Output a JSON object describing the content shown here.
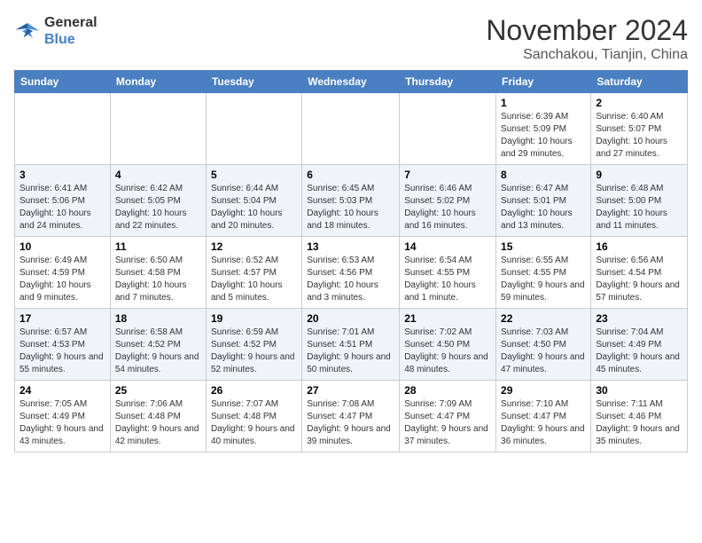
{
  "logo": {
    "line1": "General",
    "line2": "Blue"
  },
  "title": "November 2024",
  "location": "Sanchakou, Tianjin, China",
  "days_of_week": [
    "Sunday",
    "Monday",
    "Tuesday",
    "Wednesday",
    "Thursday",
    "Friday",
    "Saturday"
  ],
  "weeks": [
    [
      {
        "num": "",
        "info": ""
      },
      {
        "num": "",
        "info": ""
      },
      {
        "num": "",
        "info": ""
      },
      {
        "num": "",
        "info": ""
      },
      {
        "num": "",
        "info": ""
      },
      {
        "num": "1",
        "info": "Sunrise: 6:39 AM\nSunset: 5:09 PM\nDaylight: 10 hours and 29 minutes."
      },
      {
        "num": "2",
        "info": "Sunrise: 6:40 AM\nSunset: 5:07 PM\nDaylight: 10 hours and 27 minutes."
      }
    ],
    [
      {
        "num": "3",
        "info": "Sunrise: 6:41 AM\nSunset: 5:06 PM\nDaylight: 10 hours and 24 minutes."
      },
      {
        "num": "4",
        "info": "Sunrise: 6:42 AM\nSunset: 5:05 PM\nDaylight: 10 hours and 22 minutes."
      },
      {
        "num": "5",
        "info": "Sunrise: 6:44 AM\nSunset: 5:04 PM\nDaylight: 10 hours and 20 minutes."
      },
      {
        "num": "6",
        "info": "Sunrise: 6:45 AM\nSunset: 5:03 PM\nDaylight: 10 hours and 18 minutes."
      },
      {
        "num": "7",
        "info": "Sunrise: 6:46 AM\nSunset: 5:02 PM\nDaylight: 10 hours and 16 minutes."
      },
      {
        "num": "8",
        "info": "Sunrise: 6:47 AM\nSunset: 5:01 PM\nDaylight: 10 hours and 13 minutes."
      },
      {
        "num": "9",
        "info": "Sunrise: 6:48 AM\nSunset: 5:00 PM\nDaylight: 10 hours and 11 minutes."
      }
    ],
    [
      {
        "num": "10",
        "info": "Sunrise: 6:49 AM\nSunset: 4:59 PM\nDaylight: 10 hours and 9 minutes."
      },
      {
        "num": "11",
        "info": "Sunrise: 6:50 AM\nSunset: 4:58 PM\nDaylight: 10 hours and 7 minutes."
      },
      {
        "num": "12",
        "info": "Sunrise: 6:52 AM\nSunset: 4:57 PM\nDaylight: 10 hours and 5 minutes."
      },
      {
        "num": "13",
        "info": "Sunrise: 6:53 AM\nSunset: 4:56 PM\nDaylight: 10 hours and 3 minutes."
      },
      {
        "num": "14",
        "info": "Sunrise: 6:54 AM\nSunset: 4:55 PM\nDaylight: 10 hours and 1 minute."
      },
      {
        "num": "15",
        "info": "Sunrise: 6:55 AM\nSunset: 4:55 PM\nDaylight: 9 hours and 59 minutes."
      },
      {
        "num": "16",
        "info": "Sunrise: 6:56 AM\nSunset: 4:54 PM\nDaylight: 9 hours and 57 minutes."
      }
    ],
    [
      {
        "num": "17",
        "info": "Sunrise: 6:57 AM\nSunset: 4:53 PM\nDaylight: 9 hours and 55 minutes."
      },
      {
        "num": "18",
        "info": "Sunrise: 6:58 AM\nSunset: 4:52 PM\nDaylight: 9 hours and 54 minutes."
      },
      {
        "num": "19",
        "info": "Sunrise: 6:59 AM\nSunset: 4:52 PM\nDaylight: 9 hours and 52 minutes."
      },
      {
        "num": "20",
        "info": "Sunrise: 7:01 AM\nSunset: 4:51 PM\nDaylight: 9 hours and 50 minutes."
      },
      {
        "num": "21",
        "info": "Sunrise: 7:02 AM\nSunset: 4:50 PM\nDaylight: 9 hours and 48 minutes."
      },
      {
        "num": "22",
        "info": "Sunrise: 7:03 AM\nSunset: 4:50 PM\nDaylight: 9 hours and 47 minutes."
      },
      {
        "num": "23",
        "info": "Sunrise: 7:04 AM\nSunset: 4:49 PM\nDaylight: 9 hours and 45 minutes."
      }
    ],
    [
      {
        "num": "24",
        "info": "Sunrise: 7:05 AM\nSunset: 4:49 PM\nDaylight: 9 hours and 43 minutes."
      },
      {
        "num": "25",
        "info": "Sunrise: 7:06 AM\nSunset: 4:48 PM\nDaylight: 9 hours and 42 minutes."
      },
      {
        "num": "26",
        "info": "Sunrise: 7:07 AM\nSunset: 4:48 PM\nDaylight: 9 hours and 40 minutes."
      },
      {
        "num": "27",
        "info": "Sunrise: 7:08 AM\nSunset: 4:47 PM\nDaylight: 9 hours and 39 minutes."
      },
      {
        "num": "28",
        "info": "Sunrise: 7:09 AM\nSunset: 4:47 PM\nDaylight: 9 hours and 37 minutes."
      },
      {
        "num": "29",
        "info": "Sunrise: 7:10 AM\nSunset: 4:47 PM\nDaylight: 9 hours and 36 minutes."
      },
      {
        "num": "30",
        "info": "Sunrise: 7:11 AM\nSunset: 4:46 PM\nDaylight: 9 hours and 35 minutes."
      }
    ]
  ]
}
